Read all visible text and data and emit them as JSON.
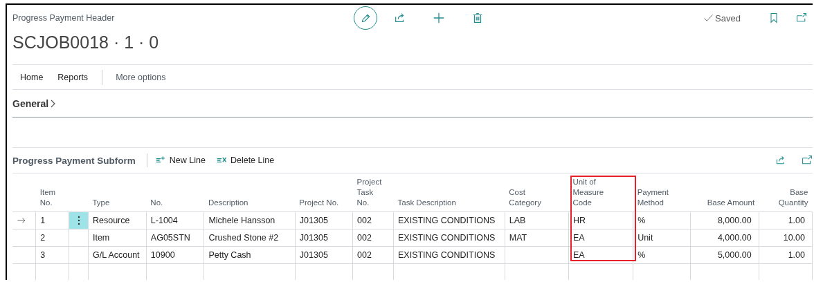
{
  "page": {
    "caption": "Progress Payment Header",
    "title": "SCJOB0018 · 1 · 0",
    "status": "Saved"
  },
  "menu": [
    {
      "label": "Home",
      "kind": "tab"
    },
    {
      "label": "Reports",
      "kind": "tab"
    },
    {
      "label": "More options",
      "kind": "more"
    }
  ],
  "general": {
    "label": "General",
    "expanded": false
  },
  "subform": {
    "title": "Progress Payment Subform",
    "actions": [
      {
        "label": "New Line",
        "kind": "new"
      },
      {
        "label": "Delete Line",
        "kind": "delete"
      }
    ]
  },
  "table": {
    "columns": [
      {
        "label": "Item No.",
        "kind": "text",
        "highlighted": false
      },
      {
        "label": "Type",
        "kind": "text",
        "highlighted": false
      },
      {
        "label": "No.",
        "kind": "text",
        "highlighted": false
      },
      {
        "label": "Description",
        "kind": "text",
        "highlighted": false
      },
      {
        "label": "Project No.",
        "kind": "text",
        "highlighted": false
      },
      {
        "label": "Project Task No.",
        "kind": "text",
        "highlighted": false
      },
      {
        "label": "Task Description",
        "kind": "text",
        "highlighted": false
      },
      {
        "label": "Cost Category",
        "kind": "text",
        "highlighted": false
      },
      {
        "label": "Unit of Measure Code",
        "kind": "text",
        "highlighted": true
      },
      {
        "label": "Payment Method",
        "kind": "text",
        "highlighted": false
      },
      {
        "label": "Base Amount",
        "kind": "number",
        "highlighted": false
      },
      {
        "label": "Base Quantity",
        "kind": "number",
        "highlighted": false
      }
    ],
    "rows": [
      {
        "selected": true,
        "cells": [
          "1",
          "Resource",
          "L-1004",
          "Michele Hansson",
          "J01305",
          "002",
          "EXISTING CONDITIONS",
          "LAB",
          "HR",
          "%",
          "8,000.00",
          "1.00"
        ]
      },
      {
        "selected": false,
        "cells": [
          "2",
          "Item",
          "AG05STN",
          "Crushed Stone #2",
          "J01305",
          "002",
          "EXISTING CONDITIONS",
          "MAT",
          "EA",
          "Unit",
          "4,000.00",
          "10.00"
        ]
      },
      {
        "selected": false,
        "cells": [
          "3",
          "G/L Account",
          "10900",
          "Petty Cash",
          "J01305",
          "002",
          "EXISTING CONDITIONS",
          null,
          "EA",
          "%",
          "5,000.00",
          "1.00"
        ]
      }
    ]
  }
}
